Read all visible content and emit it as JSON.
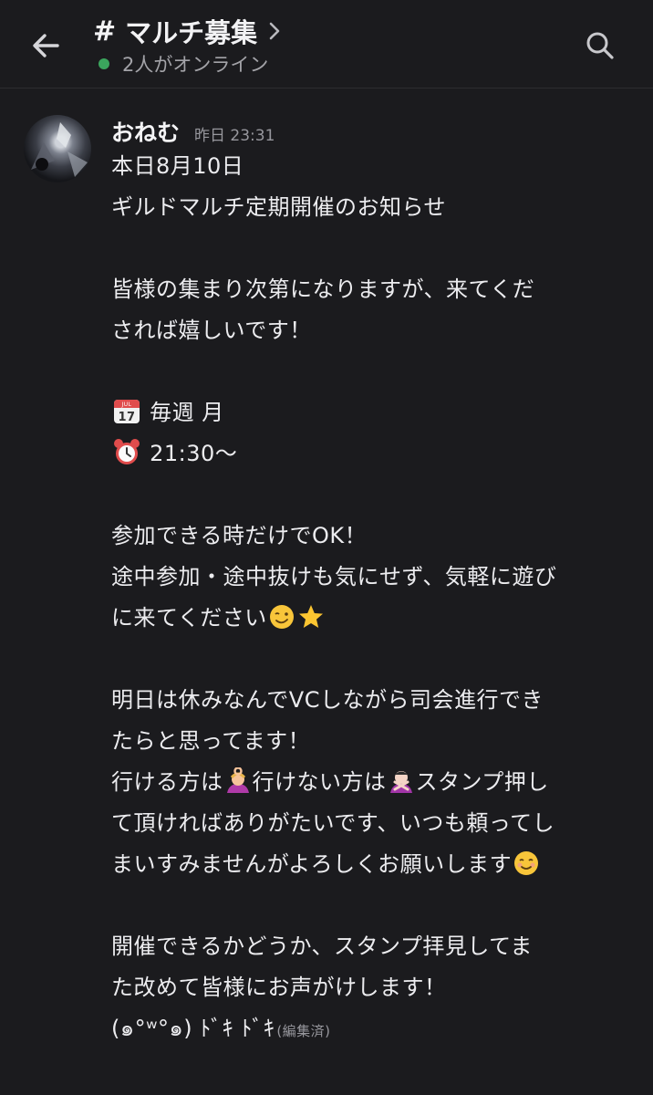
{
  "header": {
    "channel_hash": "#",
    "channel_name": "マルチ募集",
    "online_text": "2人がオンライン"
  },
  "message": {
    "author": "おねむ",
    "timestamp": "昨日 23:31",
    "lines": {
      "l1": "本日8月10日",
      "l2": "ギルドマルチ定期開催のお知らせ",
      "l3": "皆様の集まり次第になりますが、来てくだ",
      "l4": "されば嬉しいです！",
      "l5": "毎週 月",
      "l6": "21:30〜",
      "l7": "参加できる時だけでOK！",
      "l8": "途中参加・途中抜けも気にせず、気軽に遊び",
      "l9": "に来てください",
      "l10": "明日は休みなんでVCしながら司会進行でき",
      "l11": "たらと思ってます！",
      "l12a": "行ける方は",
      "l12b": "行けない方は",
      "l12c": "スタンプ押し",
      "l13": "て頂ければありがたいです、いつも頼ってし",
      "l14": "まいすみませんがよろしくお願いします",
      "l15": "開催できるかどうか、スタンプ拝見してま",
      "l16": "た改めて皆様にお声がけします！",
      "l17": "(๑°ʷ°๑) ﾄﾞｷ ﾄﾞｷ",
      "edited": "(編集済)"
    },
    "calendar_day": "17",
    "calendar_month": "JUL"
  },
  "icons": [
    "back-arrow-icon",
    "chevron-right-icon",
    "search-icon",
    "calendar-emoji",
    "alarm-clock-emoji",
    "wink-emoji",
    "star-emoji",
    "ok-gesture-emoji",
    "no-gesture-emoji",
    "smiling-emoji"
  ],
  "colors": {
    "background": "#1b1b1e",
    "online_dot": "#3ba55d",
    "muted_text": "#97979d"
  }
}
